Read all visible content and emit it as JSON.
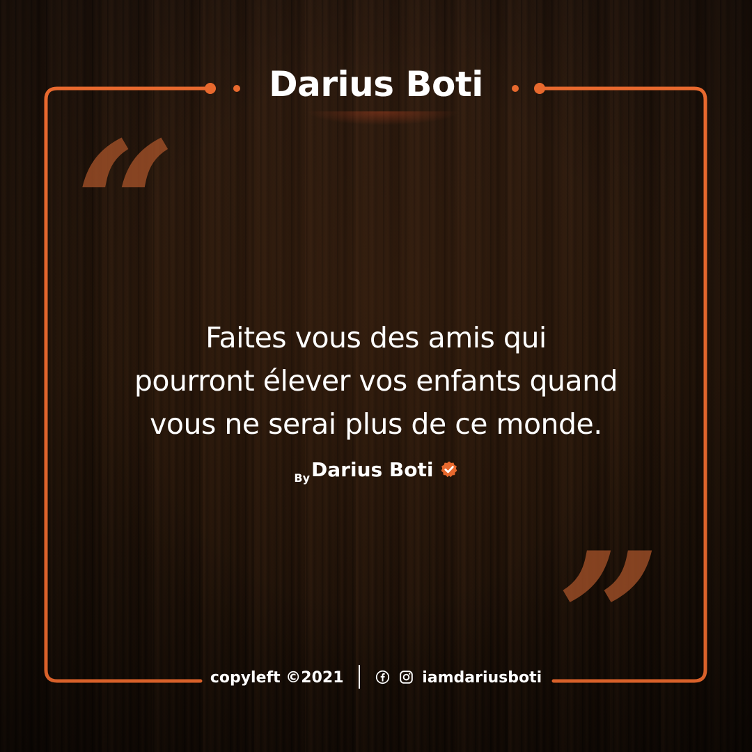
{
  "header": {
    "title": "Darius Boti"
  },
  "quote": {
    "lines": [
      "Faites vous des amis qui",
      "pourront élever vos enfants quand",
      "vous ne serai plus de ce monde."
    ]
  },
  "byline": {
    "prefix": "By",
    "author": "Darius Boti",
    "badge_icon": "verified-badge-icon"
  },
  "footer": {
    "copyright": "copyleft ©2021",
    "handle": "iamdariusboti",
    "icons": [
      "facebook-icon",
      "instagram-icon"
    ]
  },
  "colors": {
    "accent": "#e8692e",
    "accent_dark": "#a9542a",
    "text": "#ffffff"
  }
}
